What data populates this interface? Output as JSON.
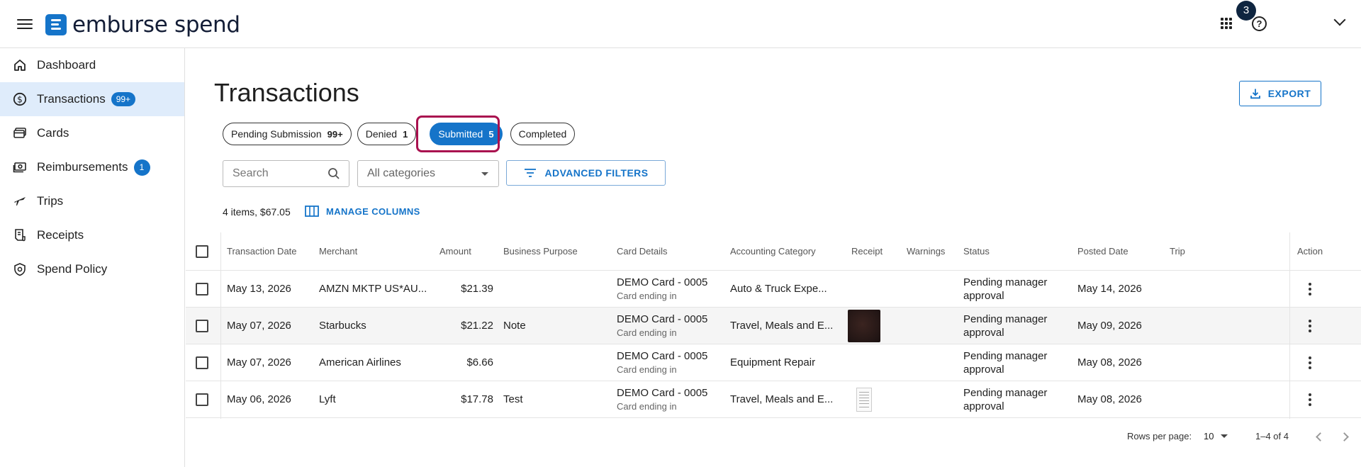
{
  "header": {
    "brand": "emburse spend",
    "notification_count": "3",
    "help_glyph": "?",
    "icons": [
      "menu-icon",
      "apps-grid-icon",
      "help-icon",
      "chevron-down-icon"
    ]
  },
  "sidebar": {
    "items": [
      {
        "label": "Dashboard",
        "icon": "home-icon"
      },
      {
        "label": "Transactions",
        "icon": "dollar-circle-icon",
        "badge": "99+"
      },
      {
        "label": "Cards",
        "icon": "cards-icon"
      },
      {
        "label": "Reimbursements",
        "icon": "cash-icon",
        "badge": "1"
      },
      {
        "label": "Trips",
        "icon": "airplane-icon"
      },
      {
        "label": "Receipts",
        "icon": "receipt-icon"
      },
      {
        "label": "Spend Policy",
        "icon": "shield-icon"
      }
    ]
  },
  "main": {
    "title": "Transactions",
    "export_label": "EXPORT",
    "tabs": [
      {
        "label": "Pending Submission",
        "count": "99+"
      },
      {
        "label": "Denied",
        "count": "1"
      },
      {
        "label": "Submitted",
        "count": "5"
      },
      {
        "label": "Completed",
        "count": ""
      }
    ],
    "selected_tab": "Submitted",
    "search_placeholder": "Search",
    "category_value": "All categories",
    "advanced_filters_label": "ADVANCED FILTERS",
    "summary": "4 items, $67.05",
    "manage_columns_label": "MANAGE COLUMNS"
  },
  "table": {
    "columns": [
      "Transaction Date",
      "Merchant",
      "Amount",
      "Business Purpose",
      "Card Details",
      "Accounting Category",
      "Receipt",
      "Warnings",
      "Status",
      "Posted Date",
      "Trip",
      "Action"
    ],
    "rows": [
      {
        "date": "May 13, 2026",
        "merchant": "AMZN MKTP US*AU...",
        "amount": "$21.39",
        "purpose": "",
        "card": "DEMO Card - 0005",
        "card_sub": "Card ending in",
        "category": "Auto & Truck Expe...",
        "receipt": "none",
        "status_1": "Pending manager",
        "status_2": "approval",
        "posted": "May 14, 2026",
        "trip": ""
      },
      {
        "date": "May 07, 2026",
        "merchant": "Starbucks",
        "amount": "$21.22",
        "purpose": "Note",
        "card": "DEMO Card - 0005",
        "card_sub": "Card ending in",
        "category": "Travel, Meals and E...",
        "receipt": "photo",
        "status_1": "Pending manager",
        "status_2": "approval",
        "posted": "May 09, 2026",
        "trip": ""
      },
      {
        "date": "May 07, 2026",
        "merchant": "American Airlines",
        "amount": "$6.66",
        "purpose": "",
        "card": "DEMO Card - 0005",
        "card_sub": "Card ending in",
        "category": "Equipment Repair",
        "receipt": "none",
        "status_1": "Pending manager",
        "status_2": "approval",
        "posted": "May 08, 2026",
        "trip": ""
      },
      {
        "date": "May 06, 2026",
        "merchant": "Lyft",
        "amount": "$17.78",
        "purpose": "Test",
        "card": "DEMO Card - 0005",
        "card_sub": "Card ending in",
        "category": "Travel, Meals and E...",
        "receipt": "document",
        "status_1": "Pending manager",
        "status_2": "approval",
        "posted": "May 08, 2026",
        "trip": ""
      }
    ]
  },
  "pagination": {
    "rows_per_page_label": "Rows per page:",
    "rows_per_page_value": "10",
    "range": "1–4 of 4"
  },
  "colors": {
    "accent": "#1574c9",
    "active_nav_bg": "#dfecfb",
    "highlight": "#a9114f"
  }
}
